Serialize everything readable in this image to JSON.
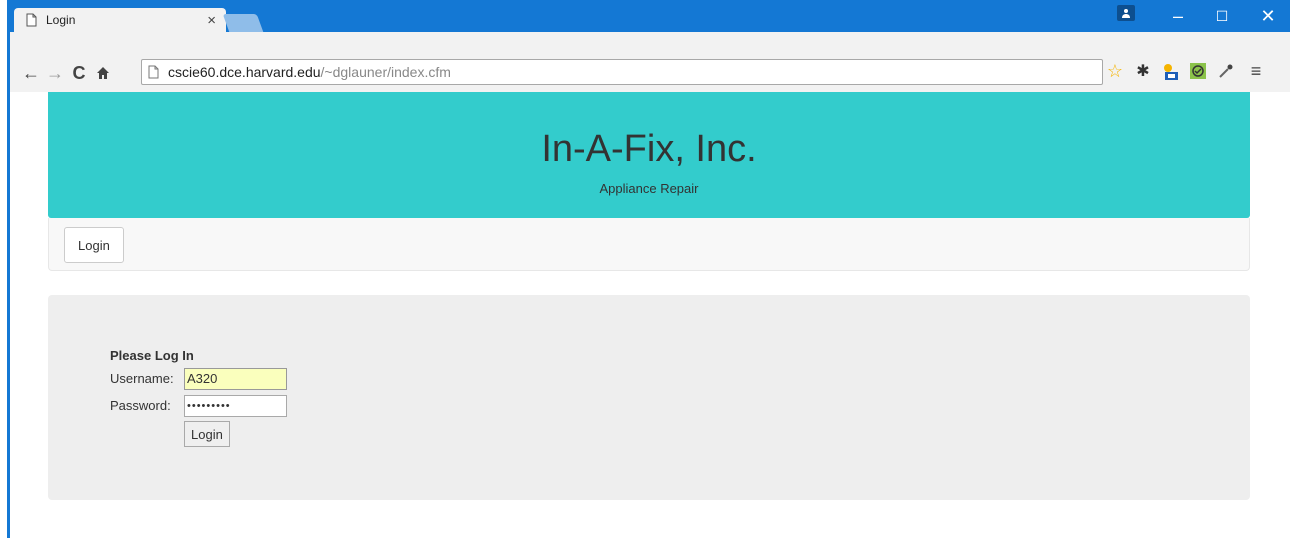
{
  "browser": {
    "tab_title": "Login",
    "url_host": "cscie60.dce.harvard.edu",
    "url_path": "/~dglauner/index.cfm"
  },
  "icons": {
    "back": "back-arrow-icon",
    "forward": "forward-arrow-icon",
    "reload": "reload-icon",
    "home": "home-icon",
    "bookmark": "star-icon",
    "extensions": [
      "gear-icon",
      "weather-icon",
      "checkmark-icon",
      "eyedropper-icon"
    ],
    "menu": "hamburger-menu-icon"
  },
  "header": {
    "company": "In-A-Fix, Inc.",
    "tagline": "Appliance Repair"
  },
  "nav": {
    "login_label": "Login"
  },
  "login_form": {
    "heading": "Please Log In",
    "username_label": "Username:",
    "username_value": "A320",
    "password_label": "Password:",
    "password_value": "•••••••••",
    "submit_label": "Login"
  },
  "colors": {
    "title_bar": "#1478d4",
    "header_bg": "#33cccc",
    "well_bg": "#eeeeee",
    "autofill_bg": "#faffbd"
  }
}
